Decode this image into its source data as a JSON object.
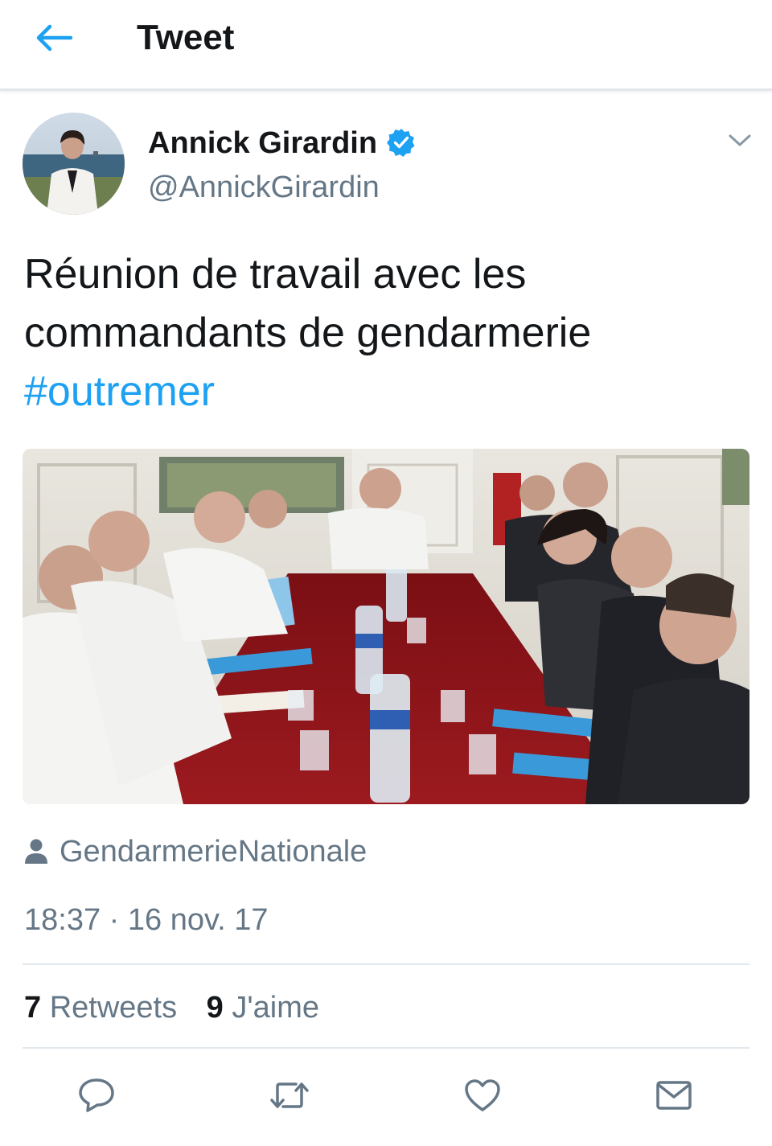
{
  "header": {
    "title": "Tweet",
    "back_icon": "arrow-left-icon"
  },
  "colors": {
    "accent": "#1da1f2",
    "secondary_text": "#657786",
    "primary_text": "#14171a",
    "divider": "#e1e8ed"
  },
  "tweet": {
    "author": {
      "display_name": "Annick Girardin",
      "handle": "@AnnickGirardin",
      "verified": true
    },
    "text_lines": [
      "Réunion de travail avec les",
      "commandants de gendarmerie"
    ],
    "hashtag": "#outremer",
    "media_credit": "GendarmerieNationale",
    "timestamp": "18:37 · 16 nov. 17",
    "stats": {
      "retweets_count": "7",
      "retweets_label": "Retweets",
      "likes_count": "9",
      "likes_label": "J'aime"
    }
  },
  "actions": [
    {
      "name": "reply",
      "icon": "reply-icon"
    },
    {
      "name": "retweet",
      "icon": "retweet-icon"
    },
    {
      "name": "like",
      "icon": "heart-icon"
    },
    {
      "name": "share",
      "icon": "envelope-icon"
    }
  ]
}
